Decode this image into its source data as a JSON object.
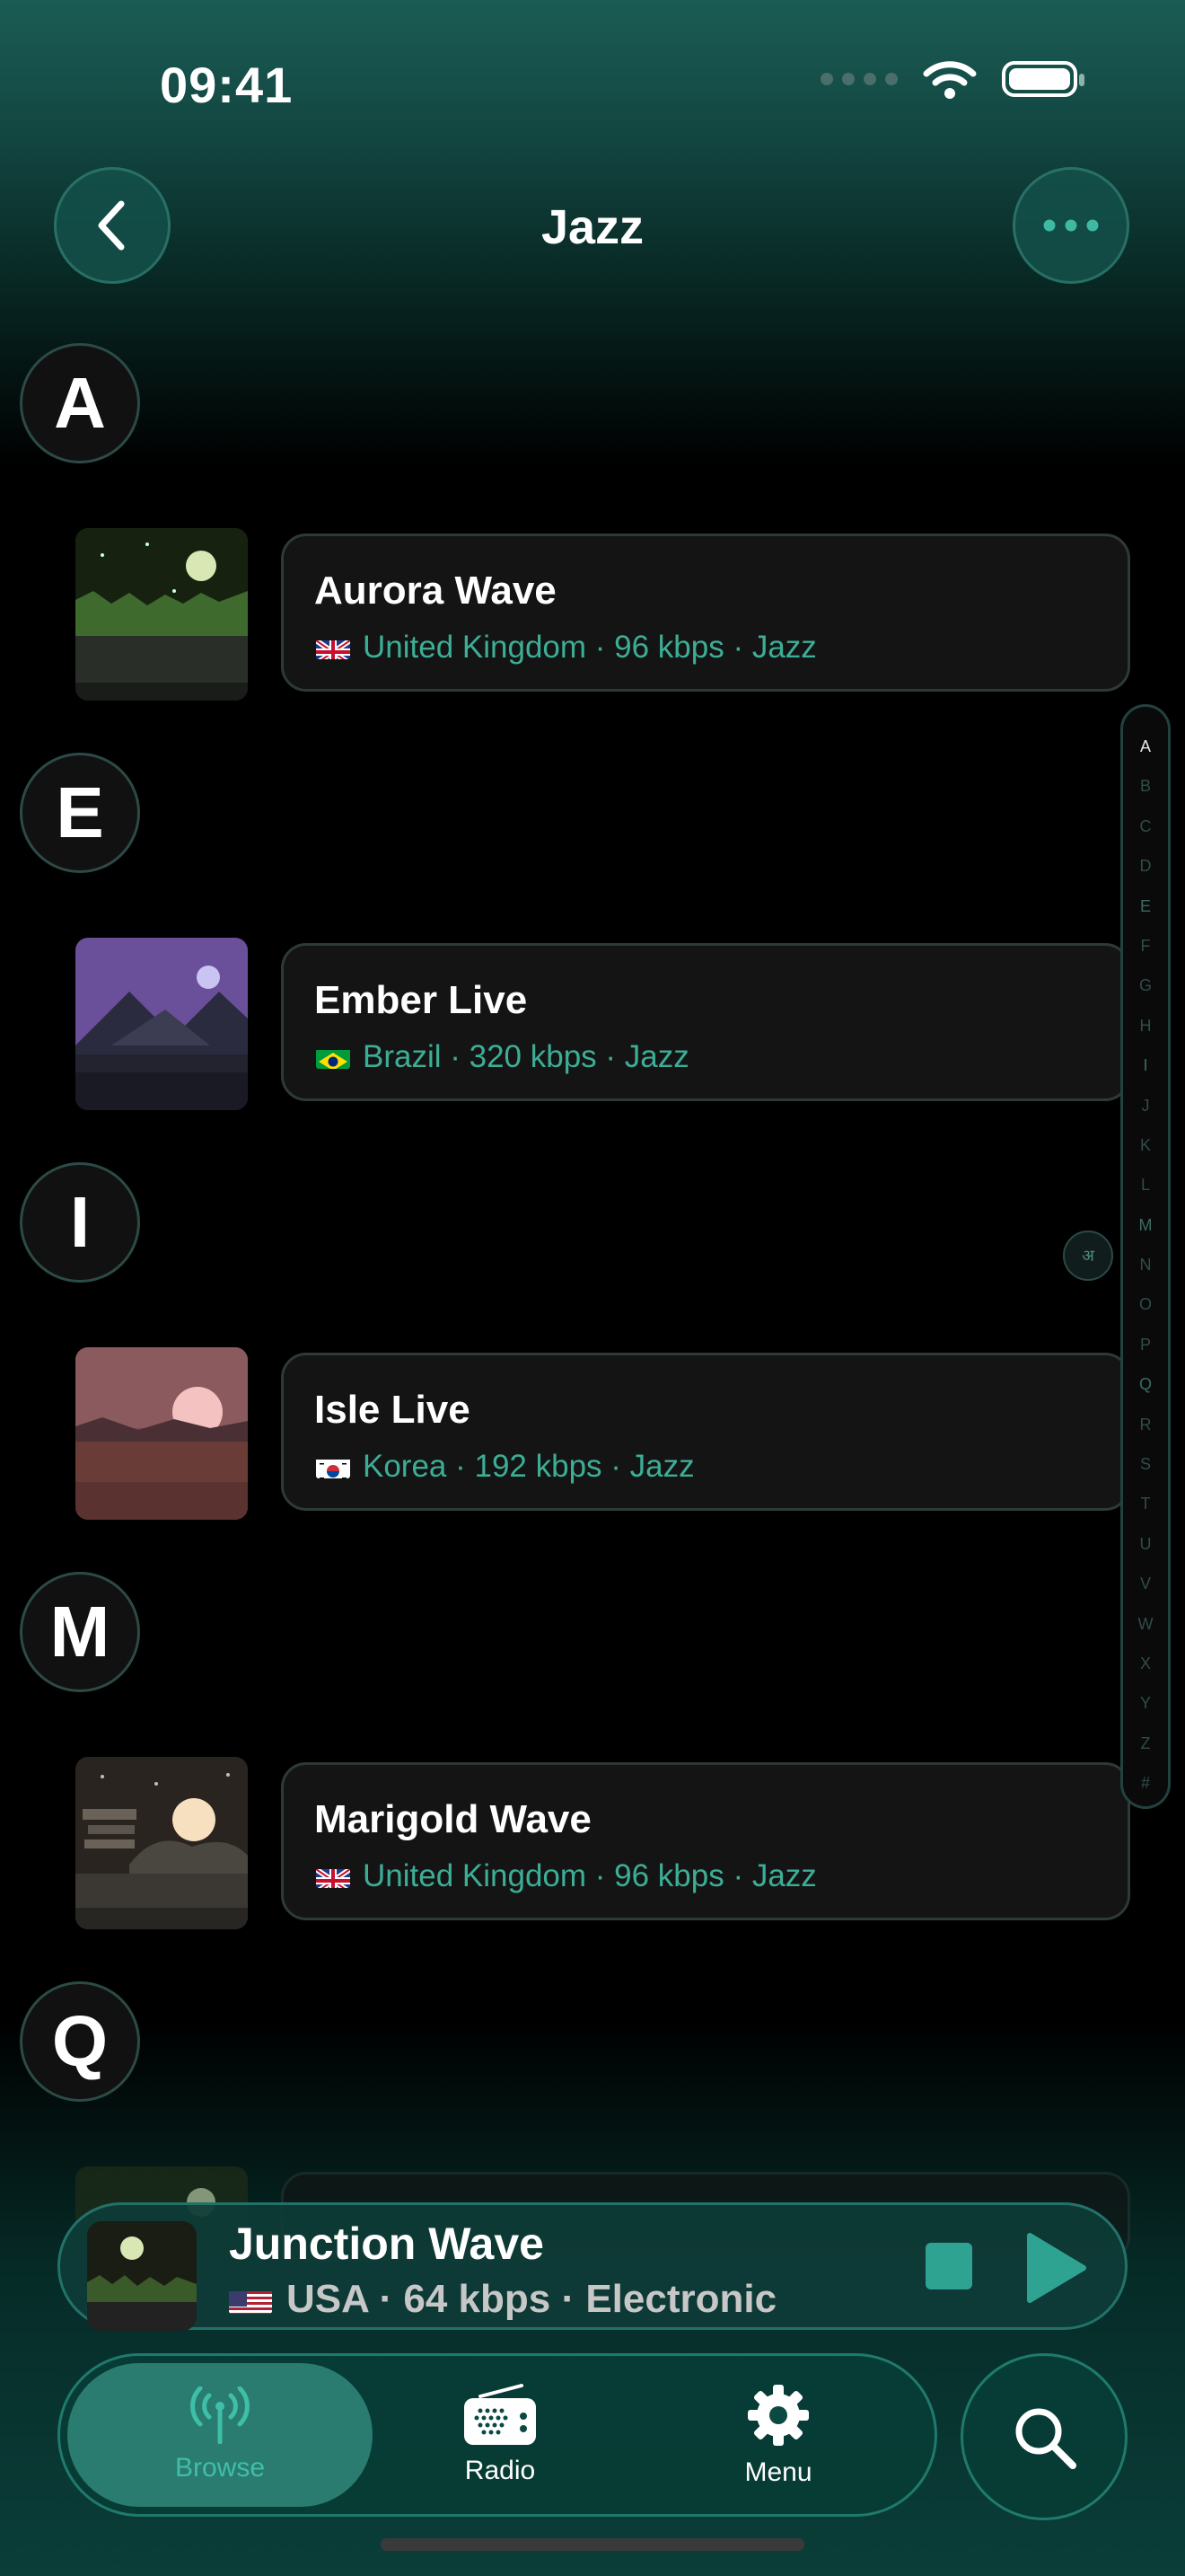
{
  "status_bar": {
    "time": "09:41"
  },
  "header": {
    "title": "Jazz",
    "back_icon": "chevron-left-icon",
    "more_icon": "ellipsis-icon"
  },
  "sections": [
    {
      "letter": "A",
      "stations": [
        {
          "name": "Aurora Wave",
          "flag": "gb",
          "meta": "United Kingdom · 96 kbps · Jazz"
        }
      ]
    },
    {
      "letter": "E",
      "stations": [
        {
          "name": "Ember Live",
          "flag": "br",
          "meta": "Brazil · 320 kbps · Jazz"
        }
      ]
    },
    {
      "letter": "I",
      "stations": [
        {
          "name": "Isle Live",
          "flag": "kr",
          "meta": "Korea · 192 kbps · Jazz"
        }
      ]
    },
    {
      "letter": "M",
      "stations": [
        {
          "name": "Marigold Wave",
          "flag": "gb",
          "meta": "United Kingdom · 96 kbps · Jazz"
        }
      ]
    },
    {
      "letter": "Q",
      "stations": []
    }
  ],
  "alphabet_index": [
    "A",
    "B",
    "C",
    "D",
    "E",
    "F",
    "G",
    "H",
    "I",
    "J",
    "K",
    "L",
    "M",
    "N",
    "O",
    "P",
    "Q",
    "R",
    "S",
    "T",
    "U",
    "V",
    "W",
    "X",
    "Y",
    "Z",
    "#"
  ],
  "index_bubble": "अ",
  "now_playing": {
    "title": "Junction Wave",
    "flag": "us",
    "meta": "USA · 64 kbps · Electronic",
    "stop_icon": "stop-icon",
    "play_icon": "play-icon"
  },
  "tabs": [
    {
      "label": "Browse",
      "icon": "antenna-icon",
      "active": true
    },
    {
      "label": "Radio",
      "icon": "radio-icon",
      "active": false
    },
    {
      "label": "Menu",
      "icon": "gear-icon",
      "active": false
    }
  ],
  "search_icon": "search-icon",
  "colors": {
    "accent": "#3dae96",
    "background": "#000000",
    "card": "#141414"
  }
}
